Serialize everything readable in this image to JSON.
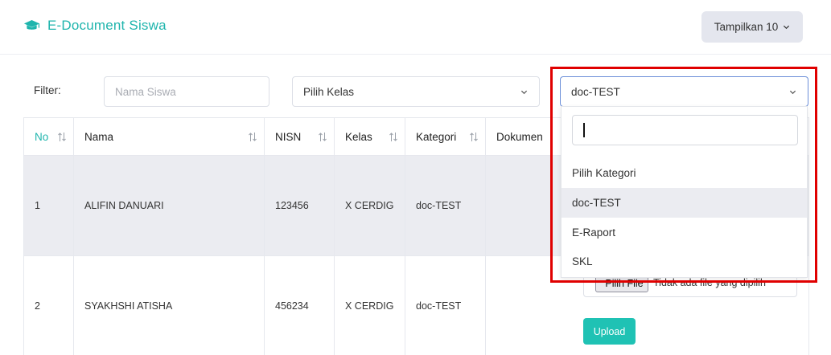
{
  "header": {
    "title": "E-Document Siswa",
    "brand_icon": "graduation-cap-icon",
    "show_button_label": "Tampilkan 10"
  },
  "filter": {
    "label": "Filter:",
    "nama_placeholder": "Nama Siswa",
    "kelas_selected": "Pilih Kelas",
    "kategori_selected": "doc-TEST"
  },
  "kategori_dropdown": {
    "search_value": "",
    "options": [
      "Pilih Kategori",
      "doc-TEST",
      "E-Raport",
      "SKL"
    ],
    "highlighted": "doc-TEST"
  },
  "table": {
    "headers": [
      "No",
      "Nama",
      "NISN",
      "Kelas",
      "Kategori",
      "Dokumen"
    ],
    "rows": [
      [
        "1",
        "ALIFIN DANUARI",
        "123456",
        "X CERDIG",
        "doc-TEST",
        ""
      ],
      [
        "2",
        "SYAKHSHI ATISHA",
        "456234",
        "X CERDIG",
        "doc-TEST",
        ""
      ]
    ]
  },
  "upload": {
    "file_button_label": "Pilih File",
    "file_status": "Tidak ada file yang dipilih",
    "upload_button_label": "Upload"
  },
  "colors": {
    "accent": "#1fb5ad",
    "upload_button": "#1fc2b4",
    "highlight_border": "#e00000",
    "row_selected_bg": "#ebecf1"
  }
}
